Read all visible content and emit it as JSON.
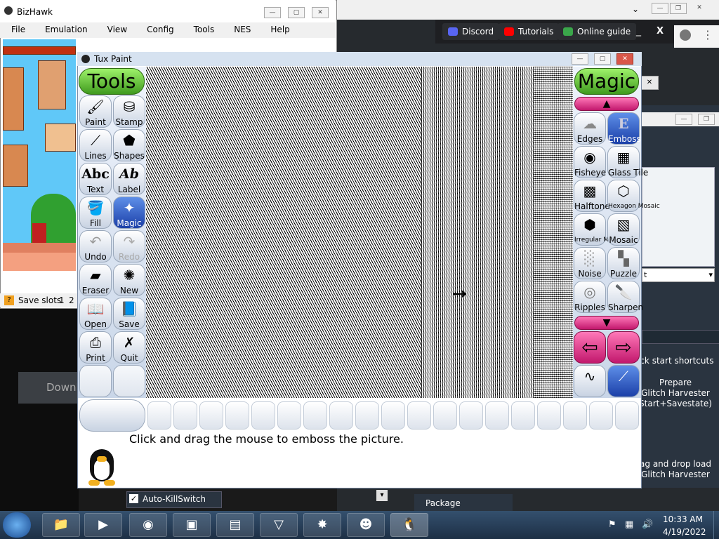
{
  "bizhawk": {
    "title": "BizHawk",
    "menu": [
      "File",
      "Emulation",
      "View",
      "Config",
      "Tools",
      "NES",
      "Help"
    ],
    "status_label": "Save slots",
    "slot1": "1",
    "slot2": "2"
  },
  "background": {
    "discord": "Discord",
    "tutorials": "Tutorials",
    "online_guide": "Online guide",
    "minimize": "_",
    "close": "X",
    "down_text": "Downl",
    "side_text": "t",
    "quick_shortcuts": "ick start shortcuts",
    "prepare_line1": "Prepare",
    "prepare_line2": "Glitch Harvester",
    "prepare_line3": "Start+Savestate)",
    "drag_line1": "ag and drop load",
    "drag_line2": "Glitch Harvester",
    "autokill": "Auto-KillSwitch",
    "package": "Package Downloader"
  },
  "tuxpaint": {
    "title": "Tux Paint",
    "tools_header": "Tools",
    "magic_header": "Magic",
    "tools": [
      {
        "label": "Paint"
      },
      {
        "label": "Stamp"
      },
      {
        "label": "Lines"
      },
      {
        "label": "Shapes"
      },
      {
        "label": "Text"
      },
      {
        "label": "Label"
      },
      {
        "label": "Fill"
      },
      {
        "label": "Magic"
      },
      {
        "label": "Undo"
      },
      {
        "label": "Redo"
      },
      {
        "label": "Eraser"
      },
      {
        "label": "New"
      },
      {
        "label": "Open"
      },
      {
        "label": "Save"
      },
      {
        "label": "Print"
      },
      {
        "label": "Quit"
      }
    ],
    "text_glyph": "Abc",
    "label_glyph": "Ab",
    "magic": [
      {
        "label": "Edges"
      },
      {
        "label": "Emboss"
      },
      {
        "label": "Fisheye"
      },
      {
        "label": "Glass Tile"
      },
      {
        "label": "Halftone"
      },
      {
        "label": "Hexagon Mosaic"
      },
      {
        "label": "Irregular Mosaic"
      },
      {
        "label": "Mosaic"
      },
      {
        "label": "Noise"
      },
      {
        "label": "Puzzle"
      },
      {
        "label": "Ripples"
      },
      {
        "label": "Sharpen"
      }
    ],
    "emboss_glyph": "E",
    "instructions": "Click and drag the mouse to emboss the picture."
  },
  "taskbar": {
    "time": "10:33 AM",
    "date": "4/19/2022"
  },
  "colors": {
    "tools_header": "#5cc23a",
    "selected_tool": "#2450c0",
    "magic_arrow": "#e0358a"
  }
}
